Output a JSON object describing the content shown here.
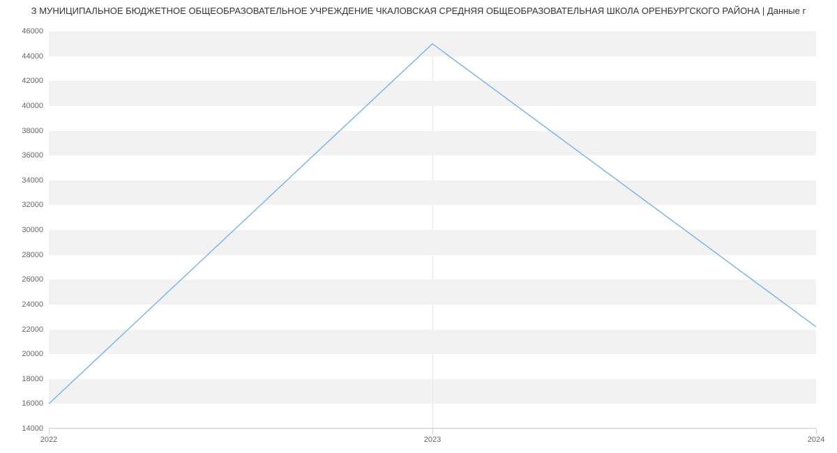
{
  "chart_data": {
    "type": "line",
    "title": "З МУНИЦИПАЛЬНОЕ БЮДЖЕТНОЕ ОБЩЕОБРАЗОВАТЕЛЬНОЕ УЧРЕЖДЕНИЕ ЧКАЛОВСКАЯ СРЕДНЯЯ ОБЩЕОБРАЗОВАТЕЛЬНАЯ ШКОЛА ОРЕНБУРГСКОГО РАЙОНА | Данные г",
    "x": [
      2022,
      2023,
      2024
    ],
    "values": [
      16000,
      45000,
      22200
    ],
    "xlabel": "",
    "ylabel": "",
    "ylim": [
      14000,
      46000
    ],
    "xlim": [
      2022,
      2024
    ],
    "y_ticks": [
      14000,
      16000,
      18000,
      20000,
      22000,
      24000,
      26000,
      28000,
      30000,
      32000,
      34000,
      36000,
      38000,
      40000,
      42000,
      44000,
      46000
    ],
    "x_ticks": [
      2022,
      2023,
      2024
    ],
    "line_color": "#7cb5ec",
    "grid_band_color": "#f2f2f2"
  }
}
